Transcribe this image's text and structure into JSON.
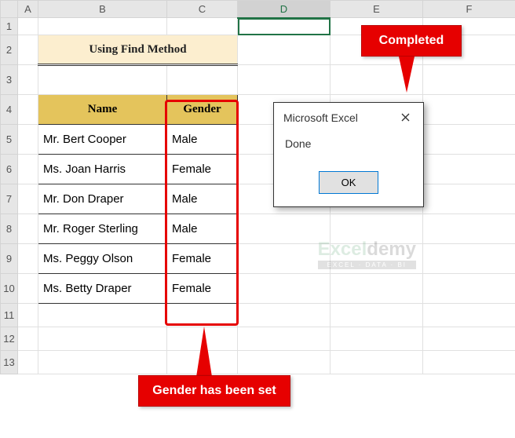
{
  "columns": {
    "A": "A",
    "B": "B",
    "C": "C",
    "D": "D",
    "E": "E",
    "F": "F"
  },
  "rows": [
    "1",
    "2",
    "3",
    "4",
    "5",
    "6",
    "7",
    "8",
    "9",
    "10",
    "11",
    "12",
    "13"
  ],
  "title": "Using Find Method",
  "headers": {
    "name": "Name",
    "gender": "Gender"
  },
  "data": [
    {
      "name": "Mr. Bert Cooper",
      "gender": "Male"
    },
    {
      "name": "Ms. Joan Harris",
      "gender": "Female"
    },
    {
      "name": "Mr. Don Draper",
      "gender": "Male"
    },
    {
      "name": "Mr. Roger Sterling",
      "gender": "Male"
    },
    {
      "name": "Ms. Peggy Olson",
      "gender": "Female"
    },
    {
      "name": "Ms. Betty Draper",
      "gender": "Female"
    }
  ],
  "callouts": {
    "top": "Completed",
    "bottom": "Gender has been set"
  },
  "dialog": {
    "title": "Microsoft Excel",
    "body": "Done",
    "ok": "OK"
  },
  "watermark": {
    "brand_a": "Excel",
    "brand_b": "demy",
    "tag": "EXCEL · DATA · BI"
  },
  "active_cell": "D1"
}
